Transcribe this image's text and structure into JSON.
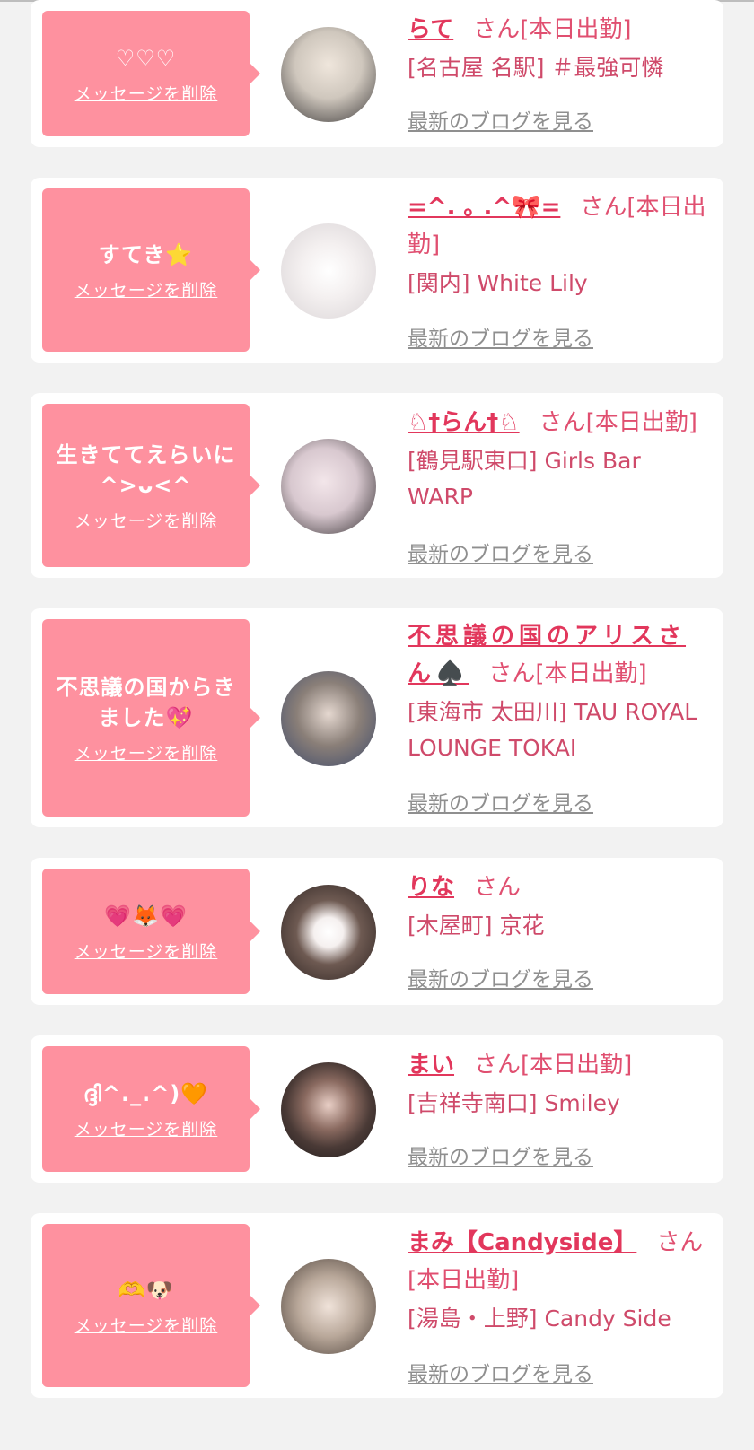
{
  "ui": {
    "delete_label": "メッセージを削除",
    "blog_label": "最新のブログを見る",
    "san_label": "さん"
  },
  "cards": [
    {
      "message": "♡♡♡",
      "name": "らて",
      "status": "[本日出勤]",
      "shop": "[名古屋 名駅] ＃最強可憐",
      "avatar_color": "#cfc7bd"
    },
    {
      "message": "すてき⭐",
      "name": "=^. ｡ .^🎀=",
      "status": "[本日出勤]",
      "shop": "[関内] White Lily",
      "avatar_color": "#ededed"
    },
    {
      "message": "生きててえらいに^>ᴗ<^",
      "name": "♘†らん†♘",
      "status": "[本日出勤]",
      "shop": "[鶴見駅東口] Girls Bar WARP",
      "avatar_color": "#d8c8cf"
    },
    {
      "message": "不思議の国からきました💖",
      "name": "不思議の国のアリスさん♠️",
      "status": "[本日出勤]",
      "shop": "[東海市 太田川] TAU ROYAL LOUNGE TOKAI",
      "avatar_color": "#8a7f78"
    },
    {
      "message": "💗🦊💗",
      "name": "りな",
      "status": "",
      "shop": "[木屋町] 京花",
      "avatar_color": "#6e5a52"
    },
    {
      "message": "ദ്ദി^._.^)🧡",
      "name": "まい",
      "status": "[本日出勤]",
      "shop": "[吉祥寺南口] Smiley",
      "avatar_color": "#4a3a36"
    },
    {
      "message": "🫶🐶",
      "name": "まみ【Candyside】",
      "status": "[本日出勤]",
      "shop": "[湯島・上野] Candy Side",
      "avatar_color": "#b9a89a"
    }
  ]
}
